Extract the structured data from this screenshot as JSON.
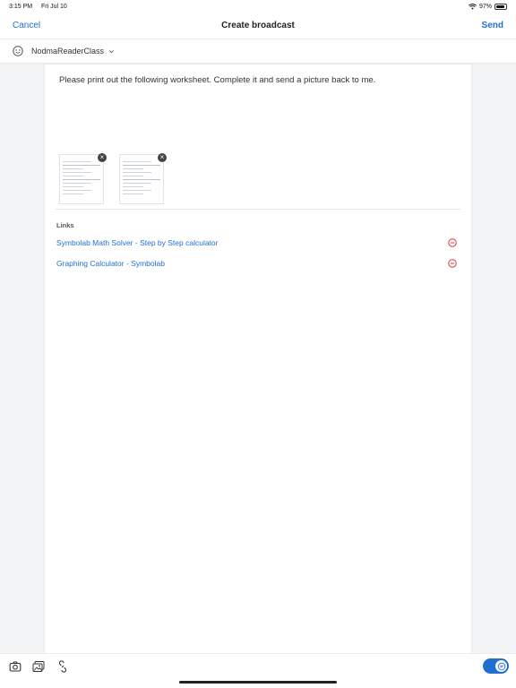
{
  "status_bar": {
    "time": "3:15 PM",
    "date": "Fri Jul 10",
    "battery": "97%"
  },
  "nav": {
    "cancel_label": "Cancel",
    "title": "Create broadcast",
    "send_label": "Send"
  },
  "class_selector": {
    "icon": "smiley-icon",
    "name": "NodmaReaderClass"
  },
  "message": "Please print out the following worksheet. Complete it and send a picture back to me.",
  "attachments": [
    {
      "icon": "worksheet-thumbnail"
    },
    {
      "icon": "worksheet-thumbnail"
    }
  ],
  "links": {
    "heading": "Links",
    "items": [
      {
        "label": "Symbolab Math Solver - Step by Step calculator"
      },
      {
        "label": "Graphing Calculator - Symbolab"
      }
    ]
  },
  "toolbar": {
    "icons": [
      "camera-icon",
      "photo-gallery-icon",
      "link-icon"
    ],
    "toggle_on": true
  },
  "colors": {
    "accent": "#1f6fd1",
    "remove": "#d9363e"
  }
}
